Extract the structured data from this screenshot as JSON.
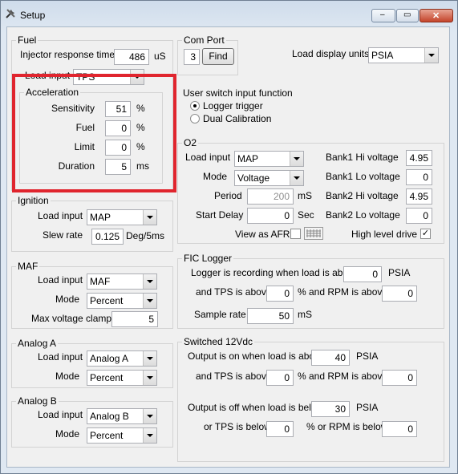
{
  "window": {
    "title": "Setup",
    "minimize": "–",
    "maximize": "▭",
    "close": "✕"
  },
  "fuel": {
    "group_title": "Fuel",
    "injector_label": "Injector response time",
    "injector_value": "486",
    "injector_unit": "uS",
    "load_input_label": "Load input",
    "load_input_value": "TPS",
    "acceleration": {
      "group_title": "Acceleration",
      "sensitivity_label": "Sensitivity",
      "sensitivity_value": "51",
      "sensitivity_unit": "%",
      "fuel_label": "Fuel",
      "fuel_value": "0",
      "fuel_unit": "%",
      "limit_label": "Limit",
      "limit_value": "0",
      "limit_unit": "%",
      "duration_label": "Duration",
      "duration_value": "5",
      "duration_unit": "ms"
    }
  },
  "com_port": {
    "group_title": "Com Port",
    "value": "3",
    "find_label": "Find"
  },
  "load_display": {
    "label": "Load display units",
    "value": "PSIA"
  },
  "user_switch": {
    "group_title": "User switch input function",
    "option1": "Logger trigger",
    "option2": "Dual Calibration",
    "selected": "Logger trigger"
  },
  "o2": {
    "group_title": "O2",
    "load_input_label": "Load input",
    "load_input_value": "MAP",
    "mode_label": "Mode",
    "mode_value": "Voltage",
    "period_label": "Period",
    "period_value": "200",
    "period_unit": "mS",
    "start_delay_label": "Start Delay",
    "start_delay_value": "0",
    "start_delay_unit": "Sec",
    "view_afr_label": "View as AFR",
    "view_afr_checked": false,
    "b1_hi_label": "Bank1 Hi voltage",
    "b1_hi_value": "4.95",
    "b1_lo_label": "Bank1 Lo voltage",
    "b1_lo_value": "0",
    "b2_hi_label": "Bank2 Hi voltage",
    "b2_hi_value": "4.95",
    "b2_lo_label": "Bank2 Lo voltage",
    "b2_lo_value": "0",
    "high_level_label": "High level drive",
    "high_level_checked": true,
    "check_mark": "✓"
  },
  "ignition": {
    "group_title": "Ignition",
    "load_input_label": "Load input",
    "load_input_value": "MAP",
    "slew_label": "Slew rate",
    "slew_value": "0.125",
    "slew_unit": "Deg/5ms"
  },
  "maf": {
    "group_title": "MAF",
    "load_input_label": "Load input",
    "load_input_value": "MAF",
    "mode_label": "Mode",
    "mode_value": "Percent",
    "clamp_label": "Max voltage clamp",
    "clamp_value": "5"
  },
  "fic_logger": {
    "group_title": "FIC Logger",
    "load_label": "Logger is recording when load is above",
    "load_value": "0",
    "load_unit": "PSIA",
    "tps_label": "and TPS is above",
    "tps_value": "0",
    "tps_unit": "%",
    "rpm_label": "and RPM is above",
    "rpm_value": "0",
    "sample_label": "Sample rate",
    "sample_value": "50",
    "sample_unit": "mS"
  },
  "analog_a": {
    "group_title": "Analog A",
    "load_input_label": "Load input",
    "load_input_value": "Analog A",
    "mode_label": "Mode",
    "mode_value": "Percent"
  },
  "analog_b": {
    "group_title": "Analog B",
    "load_input_label": "Load input",
    "load_input_value": "Analog B",
    "mode_label": "Mode",
    "mode_value": "Percent"
  },
  "switched12": {
    "group_title": "Switched 12Vdc",
    "on_load_label": "Output is on when load is above",
    "on_load_value": "40",
    "on_load_unit": "PSIA",
    "on_tps_label": "and TPS is above",
    "on_tps_value": "0",
    "on_tps_unit": "%",
    "on_rpm_label": "and RPM is above",
    "on_rpm_value": "0",
    "off_load_label": "Output is off when load is below",
    "off_load_value": "30",
    "off_load_unit": "PSIA",
    "off_tps_label": "or TPS is below",
    "off_tps_value": "0",
    "off_tps_unit": "%",
    "off_rpm_label": "or RPM is below",
    "off_rpm_value": "0"
  },
  "colors": {
    "highlight_box": "#e0252e",
    "window_bg": "#f0f0f0"
  },
  "icons": [
    "tools-icon",
    "minimize-icon",
    "maximize-icon",
    "close-icon",
    "grid-icon"
  ]
}
